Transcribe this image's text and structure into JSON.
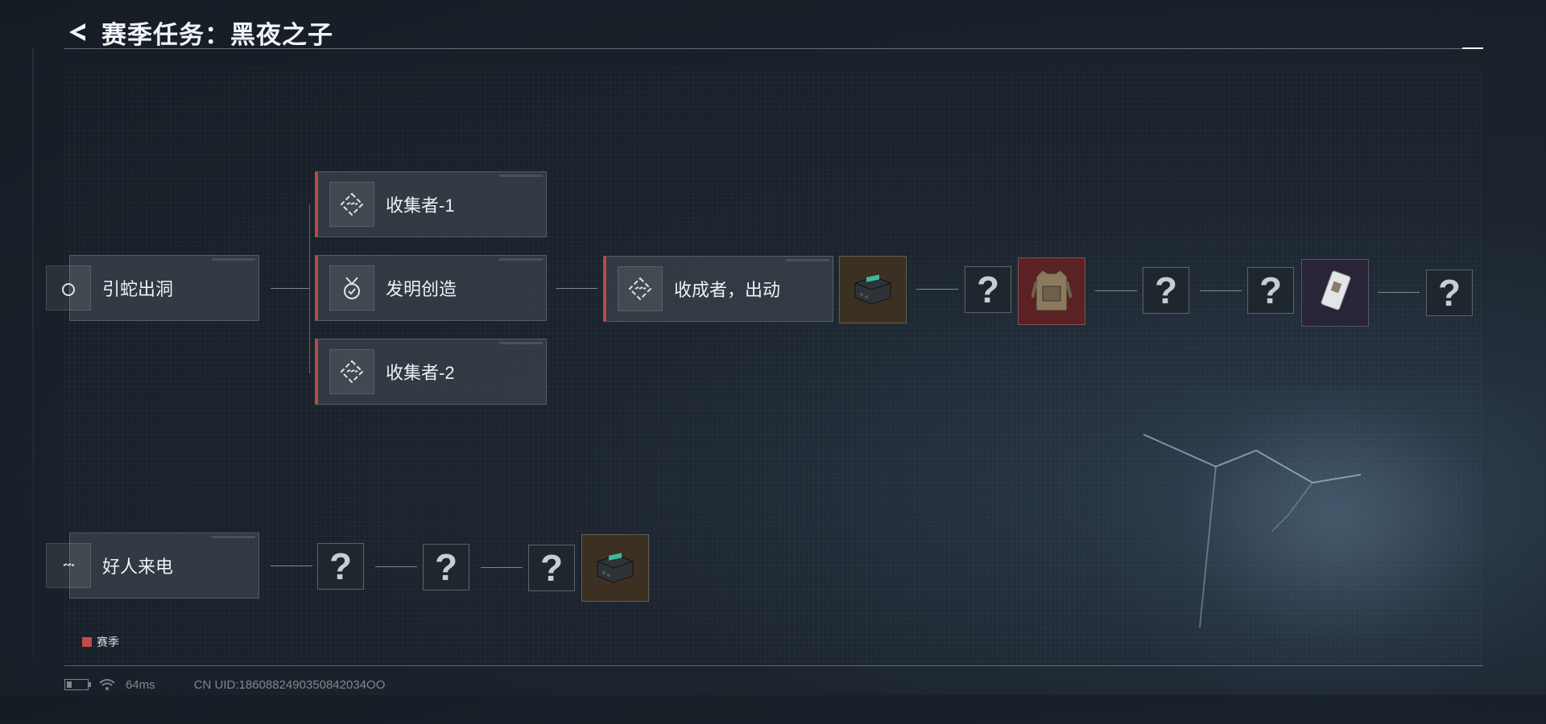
{
  "header": {
    "title": "赛季任务：黑夜之子"
  },
  "quests": {
    "yin_she": "引蛇出洞",
    "collector_1": "收集者-1",
    "invention": "发明创造",
    "collector_2": "收集者-2",
    "harvest": "收成者，出动",
    "good_call": "好人来电"
  },
  "unknown_mark": "?",
  "legend": {
    "label": "赛季",
    "color": "#c5484a"
  },
  "status": {
    "ping": "64ms",
    "uid": "CN UID:1860882490350842034OO"
  },
  "colors": {
    "accent_red": "#b94a48",
    "bg": "#1c252f"
  }
}
